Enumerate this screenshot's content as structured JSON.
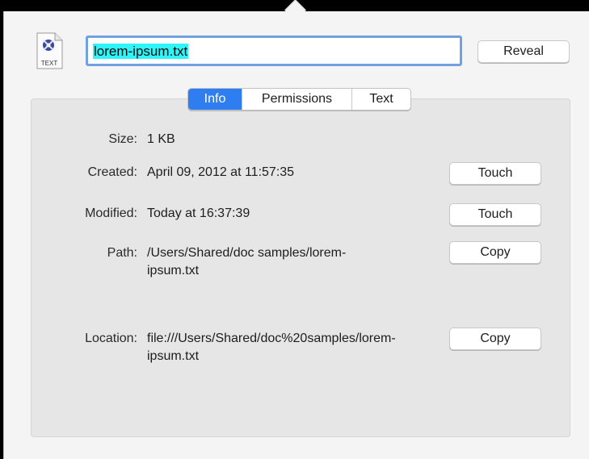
{
  "file": {
    "icon": "text-document-icon",
    "icon_caption": "TEXT",
    "name": "lorem-ipsum.txt"
  },
  "header": {
    "reveal_label": "Reveal"
  },
  "tabs": [
    {
      "label": "Info",
      "active": true
    },
    {
      "label": "Permissions",
      "active": false
    },
    {
      "label": "Text",
      "active": false
    }
  ],
  "info": {
    "size": {
      "label": "Size:",
      "value": "1 KB"
    },
    "created": {
      "label": "Created:",
      "value": "April 09, 2012 at 11:57:35",
      "button": "Touch"
    },
    "modified": {
      "label": "Modified:",
      "value": "Today at 16:37:39",
      "button": "Touch"
    },
    "path": {
      "label": "Path:",
      "value": "/Users/Shared/doc samples/lorem-ipsum.txt",
      "button": "Copy"
    },
    "location": {
      "label": "Location:",
      "value": "file:///Users/Shared/doc%20samples/lorem-ipsum.txt",
      "button": "Copy"
    }
  },
  "colors": {
    "accent": "#2f7ef1",
    "selection": "#2ff4f8",
    "focus_ring": "#71a2df"
  }
}
